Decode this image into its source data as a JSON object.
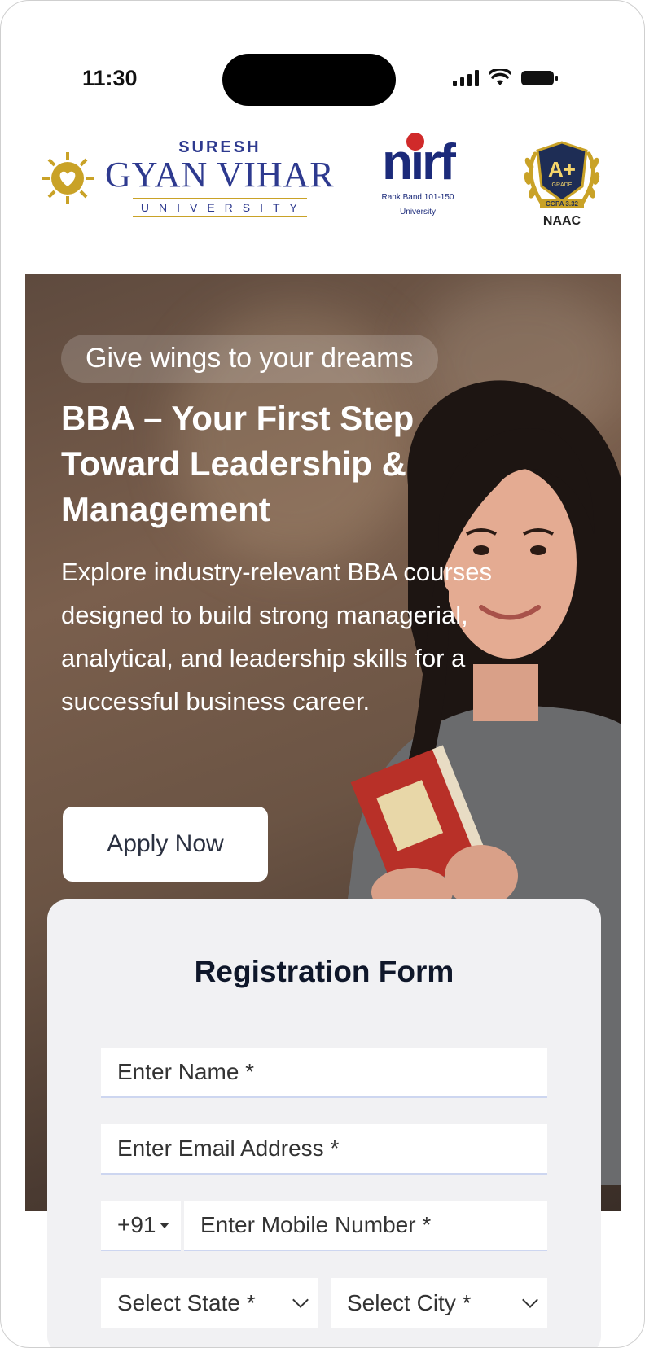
{
  "status_bar": {
    "time": "11:30"
  },
  "logos": {
    "sgvu": {
      "top": "SURESH",
      "middle": "GYAN VIHAR",
      "bottom": "UNIVERSITY"
    },
    "nirf": {
      "word": "nirf",
      "sub1": "Rank Band 101-150",
      "sub2": "University"
    },
    "naac": {
      "grade": "A+",
      "grade_sub": "GRADE",
      "cgpa": "CGPA 3.32",
      "label": "NAAC"
    }
  },
  "hero": {
    "tagline": "Give wings to your dreams",
    "title": "BBA – Your First Step Toward Leadership & Management",
    "description": "Explore industry-relevant BBA courses designed to build strong managerial, analytical, and leadership skills for a successful business career.",
    "apply_label": "Apply Now"
  },
  "form": {
    "title": "Registration Form",
    "name_placeholder": "Enter Name *",
    "email_placeholder": "Enter Email Address *",
    "country_code": "+91",
    "mobile_placeholder": "Enter Mobile Number *",
    "state_placeholder": "Select State *",
    "city_placeholder": "Select City *"
  }
}
